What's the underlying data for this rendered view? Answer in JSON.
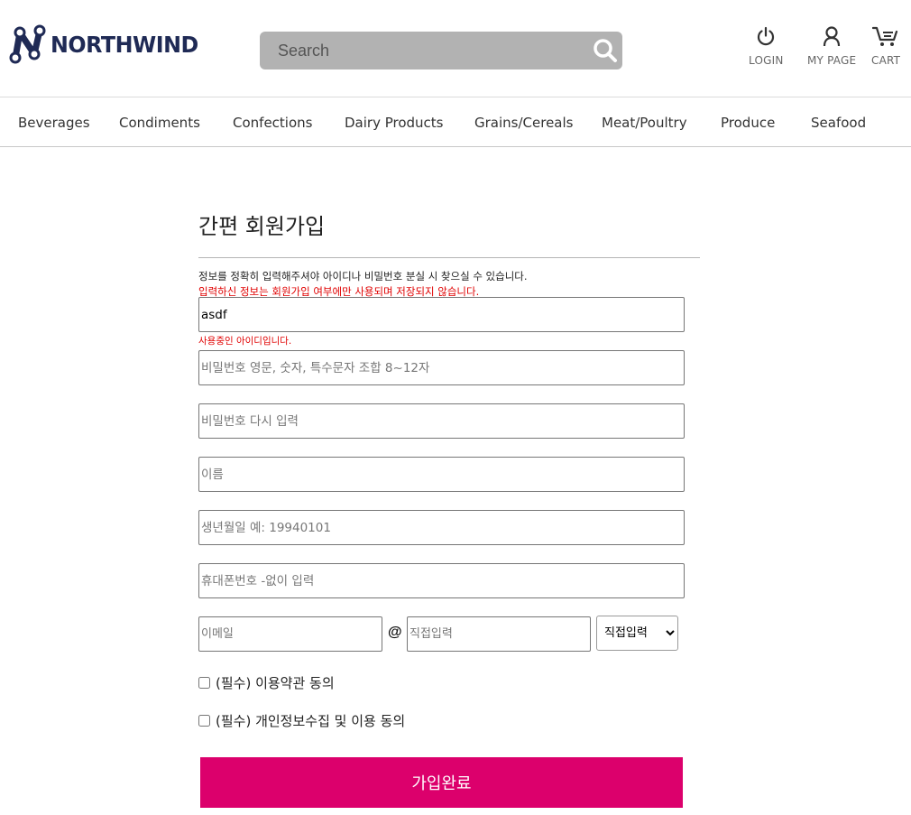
{
  "brand": {
    "name": "NORTHWIND",
    "color": "#1f2a55"
  },
  "search": {
    "placeholder": "Search"
  },
  "utils": {
    "login": "LOGIN",
    "mypage": "MY PAGE",
    "cart": "CART"
  },
  "nav": {
    "items": [
      "Beverages",
      "Condiments",
      "Confections",
      "Dairy Products",
      "Grains/Cereals",
      "Meat/Poultry",
      "Produce",
      "Seafood"
    ]
  },
  "form": {
    "title": "간편 회원가입",
    "notice": "정보를 정확히 입력해주셔야 아이디나 비밀번호 분실 시 찾으실 수 있습니다.",
    "notice_warning": "입력하신 정보는 회원가입 여부에만 사용되며 저장되지 않습니다.",
    "id_value": "asdf",
    "id_message": "사용중인 아이디입니다.",
    "password_placeholder": "비밀번호 영문, 숫자, 특수문자 조합 8~12자",
    "password_confirm_placeholder": "비밀번호 다시 입력",
    "name_placeholder": "이름",
    "birth_placeholder": "생년월일 예: 19940101",
    "phone_placeholder": "휴대폰번호 -없이 입력",
    "email_placeholder": "이메일",
    "at_sign": "@",
    "domain_placeholder": "직접입력",
    "domain_selected": "직접입력",
    "agree_terms": "(필수) 이용약관 동의",
    "agree_privacy": "(필수) 개인정보수집 및 이용 동의",
    "submit_label": "가입완료",
    "accent_color": "#dc006c",
    "warning_color": "#e00000"
  }
}
